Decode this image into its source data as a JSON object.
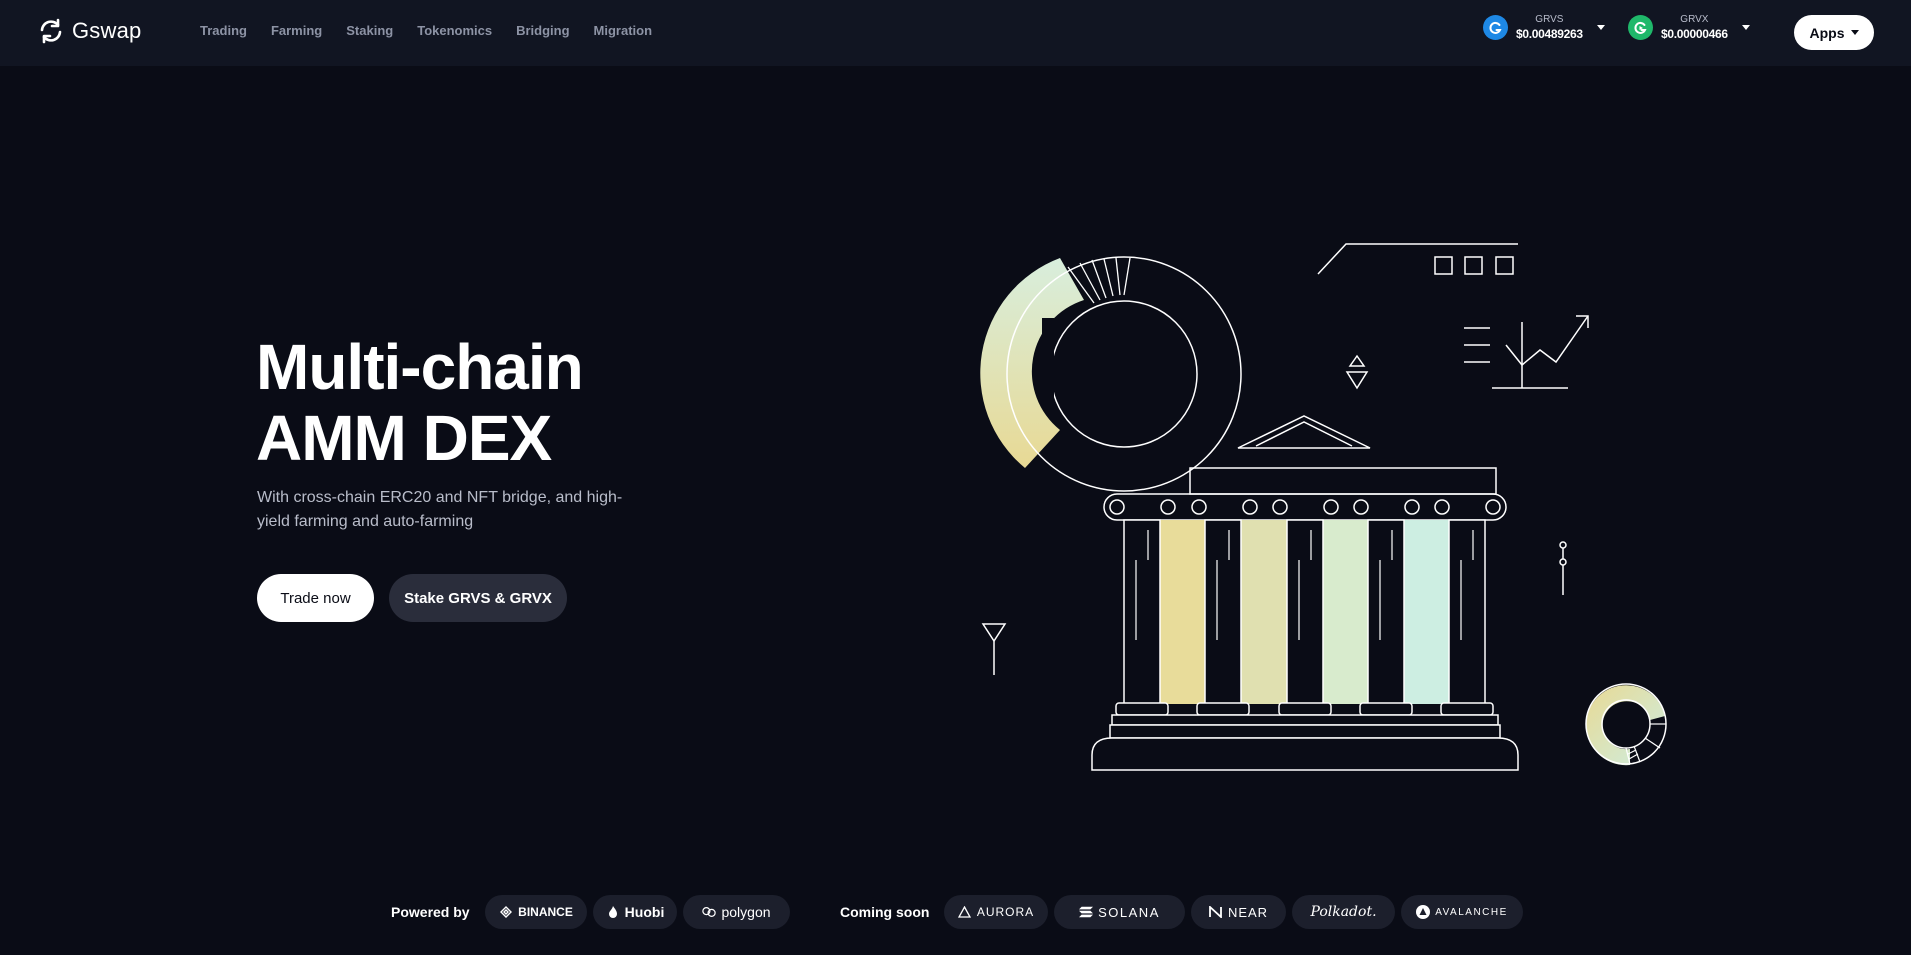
{
  "brand": {
    "name": "Gswap",
    "icon": "refresh-logo-icon"
  },
  "nav": {
    "items": [
      {
        "label": "Trading"
      },
      {
        "label": "Farming"
      },
      {
        "label": "Staking"
      },
      {
        "label": "Tokenomics"
      },
      {
        "label": "Bridging"
      },
      {
        "label": "Migration"
      }
    ]
  },
  "tickers": [
    {
      "name": "GRVS",
      "price": "$0.00489263",
      "color": "#1e88e5",
      "icon": "grvs-coin-icon"
    },
    {
      "name": "GRVX",
      "price": "$0.00000466",
      "color": "#1fb86a",
      "icon": "grvx-coin-icon"
    }
  ],
  "apps_button": {
    "label": "Apps"
  },
  "hero": {
    "title_line1": "Multi-chain",
    "title_line2": "AMM DEX",
    "subtitle": "With cross-chain ERC20 and NFT bridge, and high-yield farming and auto-farming",
    "primary_cta": "Trade now",
    "secondary_cta": "Stake GRVS & GRVX"
  },
  "powered_by": {
    "label": "Powered by",
    "chains": [
      {
        "name": "BINANCE",
        "icon": "binance-icon"
      },
      {
        "name": "Huobi",
        "icon": "huobi-flame-icon"
      },
      {
        "name": "polygon",
        "icon": "polygon-icon"
      }
    ]
  },
  "coming_soon": {
    "label": "Coming soon",
    "chains": [
      {
        "name": "AURORA",
        "icon": "aurora-icon"
      },
      {
        "name": "SOLANA",
        "icon": "solana-icon"
      },
      {
        "name": "NEAR",
        "icon": "near-icon"
      },
      {
        "name": "Polkadot.",
        "icon": "polkadot-icon"
      },
      {
        "name": "AVALANCHE",
        "icon": "avalanche-icon"
      }
    ]
  },
  "colors": {
    "background": "#0a0c16",
    "header": "#111522",
    "accent_yellow": "#e8dc9a",
    "accent_mint": "#cdeee2"
  }
}
